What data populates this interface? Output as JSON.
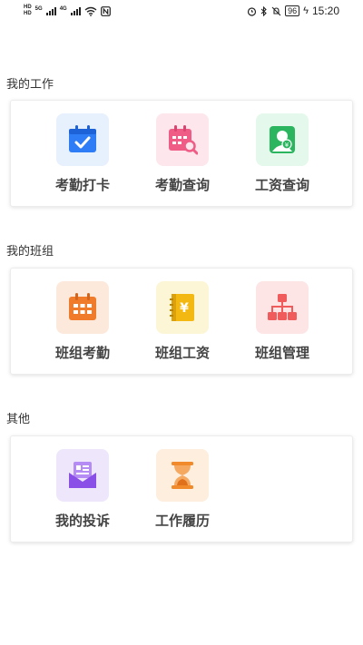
{
  "status_bar": {
    "hd_top": "HD",
    "hd_bottom": "HD",
    "net_5g": "5G",
    "net_4g": "4G",
    "battery": "96",
    "time": "15:20"
  },
  "sections": [
    {
      "title": "我的工作",
      "items": [
        {
          "label": "考勤打卡",
          "icon": "calendar-check-icon",
          "bg": "#e7f0fd",
          "color": "#2f7df6"
        },
        {
          "label": "考勤查询",
          "icon": "calendar-search-icon",
          "bg": "#fde6ec",
          "color": "#ef5d86"
        },
        {
          "label": "工资查询",
          "icon": "salary-card-icon",
          "bg": "#e5f8ec",
          "color": "#2bb55f"
        }
      ]
    },
    {
      "title": "我的班组",
      "items": [
        {
          "label": "班组考勤",
          "icon": "team-calendar-icon",
          "bg": "#fde9dc",
          "color": "#f07b2b"
        },
        {
          "label": "班组工资",
          "icon": "team-salary-book-icon",
          "bg": "#fdf6d6",
          "color": "#f4b812"
        },
        {
          "label": "班组管理",
          "icon": "org-chart-icon",
          "bg": "#fde5e5",
          "color": "#f05b5b"
        }
      ]
    },
    {
      "title": "其他",
      "items": [
        {
          "label": "我的投诉",
          "icon": "complaint-mail-icon",
          "bg": "#eee7fc",
          "color": "#8a4fe6"
        },
        {
          "label": "工作履历",
          "icon": "hourglass-icon",
          "bg": "#fdeedd",
          "color": "#f08a2b"
        }
      ]
    }
  ]
}
